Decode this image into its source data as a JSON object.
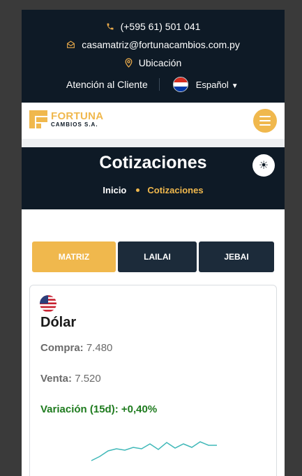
{
  "topbar": {
    "phone": "(+595 61) 501 041",
    "email": "casamatriz@fortunacambios.com.py",
    "location": "Ubicación",
    "support": "Atención al Cliente",
    "language": "Español"
  },
  "logo": {
    "line1": "FORTUNA",
    "line2": "CAMBIOS S.A."
  },
  "banner": {
    "title": "Cotizaciones",
    "crumb_home": "Inicio",
    "crumb_current": "Cotizaciones"
  },
  "tabs": [
    {
      "label": "MATRIZ",
      "active": true
    },
    {
      "label": "LAILAI",
      "active": false
    },
    {
      "label": "JEBAI",
      "active": false
    }
  ],
  "card": {
    "currency": "Dólar",
    "compra_label": "Compra:",
    "compra_value": "7.480",
    "venta_label": "Venta:",
    "venta_value": "7.520",
    "variacion": "Variación (15d): +0,40%"
  },
  "colors": {
    "accent": "#f0b84d",
    "dark": "#0e1a26",
    "positive": "#1e7b1e",
    "sparkline": "#3fb8b8"
  },
  "icons": [
    "phone-icon",
    "mail-icon",
    "location-icon",
    "paraguay-flag-icon",
    "chevron-down-icon",
    "menu-icon",
    "sun-icon",
    "usa-flag-icon"
  ]
}
